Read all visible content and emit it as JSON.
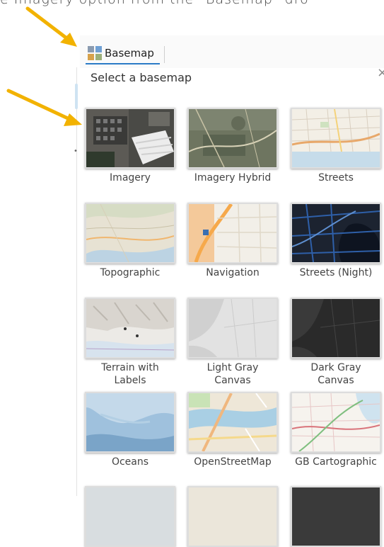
{
  "caption": {
    "text": "e Imagery option from the \"Basemap\" dro"
  },
  "toolbar": {
    "tab_label": "Basemap"
  },
  "panel": {
    "header": "Select a basemap",
    "close_glyph": "×"
  },
  "basemaps": [
    {
      "label": "Imagery"
    },
    {
      "label": "Imagery Hybrid"
    },
    {
      "label": "Streets"
    },
    {
      "label": "Topographic"
    },
    {
      "label": "Navigation"
    },
    {
      "label": "Streets (Night)"
    },
    {
      "label": "Terrain with\nLabels"
    },
    {
      "label": "Light Gray\nCanvas"
    },
    {
      "label": "Dark Gray\nCanvas"
    },
    {
      "label": "Oceans"
    },
    {
      "label": "OpenStreetMap"
    },
    {
      "label": "GB Cartographic"
    }
  ],
  "colors": {
    "accent": "#2b7bc7",
    "arrow": "#f2b200"
  }
}
